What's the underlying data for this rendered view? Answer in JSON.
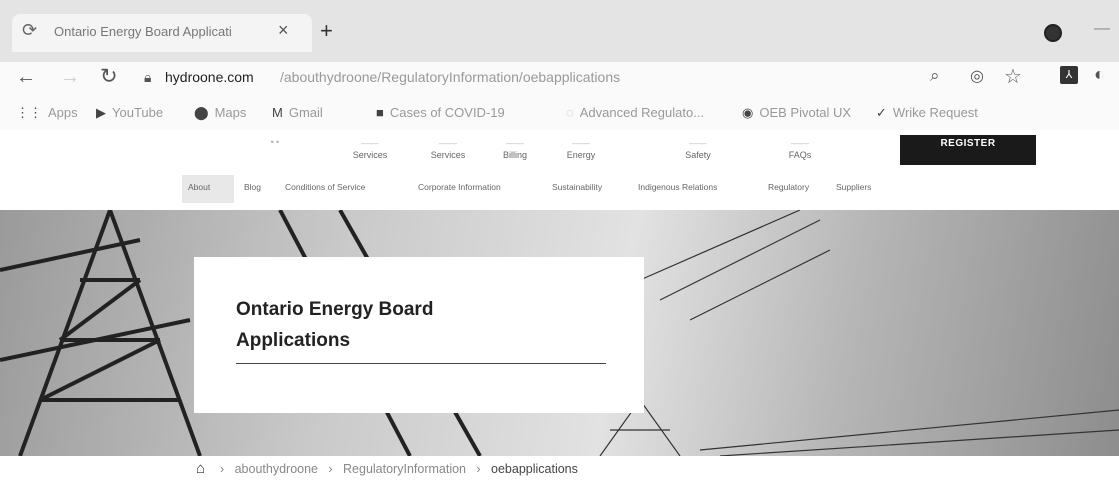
{
  "browser": {
    "tab_title": "Ontario Energy Board Applicati",
    "tab_close": "×",
    "new_tab": "+",
    "url_host": "hydroone.com",
    "url_path": "/abouthydroone/RegulatoryInformation/oebapplications"
  },
  "bookmarks": [
    {
      "label": "Apps",
      "icon": "apps-grid-icon"
    },
    {
      "label": "YouTube",
      "icon": "youtube-icon"
    },
    {
      "label": "Maps",
      "icon": "maps-pin-icon"
    },
    {
      "label": "Gmail",
      "icon": "gmail-icon"
    },
    {
      "label": "Cases of COVID-19",
      "icon": "bookmark-icon"
    },
    {
      "label": "Advanced Regulato...",
      "icon": "globe-icon"
    },
    {
      "label": "OEB Pivotal UX",
      "icon": "chrome-icon"
    },
    {
      "label": "Wrike Request",
      "icon": "wrike-icon"
    }
  ],
  "site_nav": [
    {
      "label": "Services"
    },
    {
      "label": "Services"
    },
    {
      "label": "Billing"
    },
    {
      "label": "Energy"
    },
    {
      "label": "Safety"
    },
    {
      "label": "FAQs"
    }
  ],
  "register_label": "REGISTER",
  "sub_nav": [
    "About",
    "Blog",
    "Conditions of Service",
    "Corporate Information",
    "Sustainability",
    "Indigenous Relations",
    "Regulatory",
    "Suppliers"
  ],
  "hero": {
    "title": "Ontario Energy Board Applications"
  },
  "breadcrumb": [
    "abouthydroone",
    "RegulatoryInformation",
    "oebapplications"
  ],
  "breadcrumb_sep": "›"
}
